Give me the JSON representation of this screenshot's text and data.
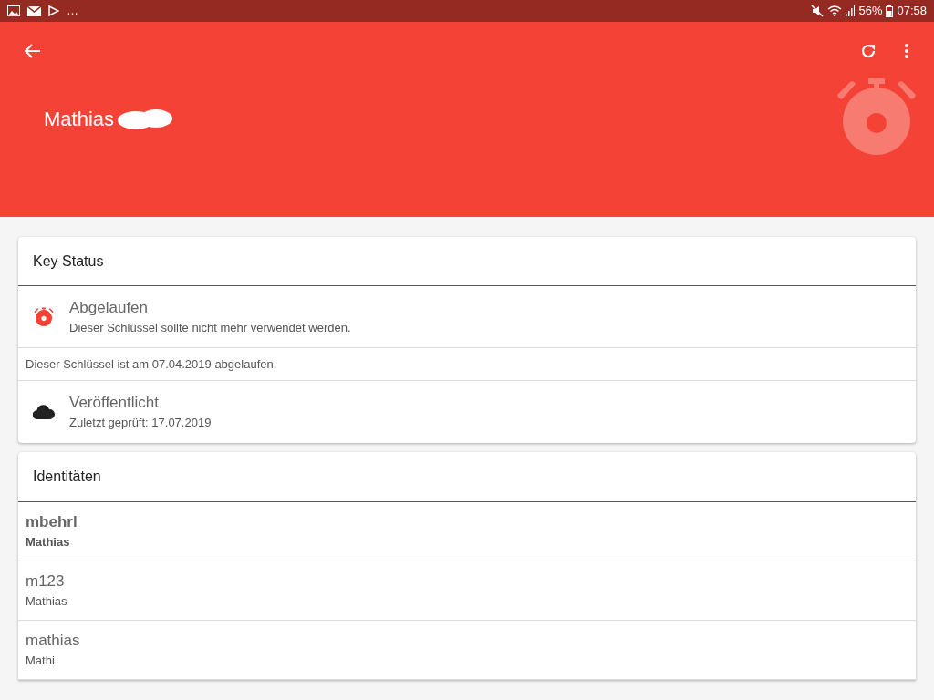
{
  "status_bar": {
    "overflow": "…",
    "battery": "56%",
    "time": "07:58"
  },
  "header": {
    "title": "Mathias"
  },
  "key_status": {
    "title": "Key Status",
    "items": [
      {
        "kind": "expired",
        "title": "Abgelaufen",
        "subtitle": "Dieser Schlüssel sollte nicht mehr verwendet werden."
      },
      {
        "kind": "note",
        "text": "Dieser Schlüssel ist am 07.04.2019 abgelaufen."
      },
      {
        "kind": "published",
        "title": "Veröffentlicht",
        "subtitle": "Zuletzt geprüft: 17.07.2019"
      }
    ]
  },
  "identities": {
    "title": "Identitäten",
    "items": [
      {
        "address": "mbehrl",
        "name": "Mathias",
        "primary": true
      },
      {
        "address": "m123",
        "name": "Mathias",
        "primary": false
      },
      {
        "address": "mathias",
        "name": "Mathi",
        "primary": false
      }
    ]
  }
}
